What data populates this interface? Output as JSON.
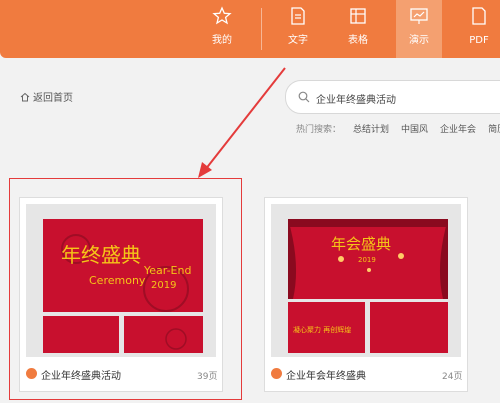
{
  "nav": {
    "items": [
      {
        "label": "我的",
        "icon": "star-icon"
      },
      {
        "label": "文字",
        "icon": "document-icon"
      },
      {
        "label": "表格",
        "icon": "table-icon"
      },
      {
        "label": "演示",
        "icon": "presentation-icon"
      },
      {
        "label": "PDF",
        "icon": "pdf-icon"
      }
    ],
    "active": "演示"
  },
  "back_label": "返回首页",
  "search": {
    "value": "企业年终盛典活动"
  },
  "hot_search": {
    "label": "热门搜索：",
    "tags": [
      "总结计划",
      "中国风",
      "企业年会",
      "简历"
    ]
  },
  "templates": [
    {
      "title": "企业年终盛典活动",
      "pages": "39页",
      "thumb_text": {
        "main": "年终盛典",
        "sub1": "Year-End",
        "sub2": "Ceremony",
        "year": "2019"
      }
    },
    {
      "title": "企业年会年终盛典",
      "pages": "24页",
      "thumb_text": {
        "main": "年会盛典",
        "year": "2019",
        "slogan": "凝心聚力 再创辉煌"
      }
    }
  ],
  "colors": {
    "brand": "#f07b3f",
    "highlight": "#e43b3b",
    "thumb_red": "#c8102e"
  }
}
